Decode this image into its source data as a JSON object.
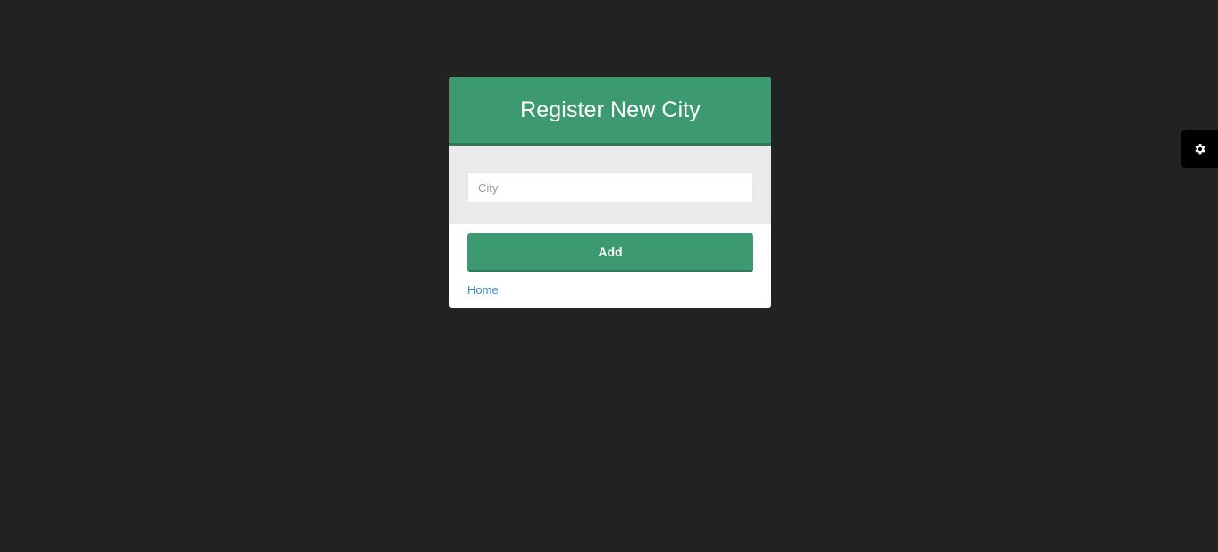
{
  "card": {
    "title": "Register New City",
    "city_input": {
      "placeholder": "City",
      "value": ""
    },
    "add_button_label": "Add",
    "home_link_label": "Home"
  },
  "settings_tab": {
    "icon": "gear-icon"
  },
  "colors": {
    "background": "#222222",
    "accent": "#3d9970",
    "accent_dark": "#2f7a58",
    "body_gray": "#eaeaec",
    "link": "#3c8dbc"
  }
}
